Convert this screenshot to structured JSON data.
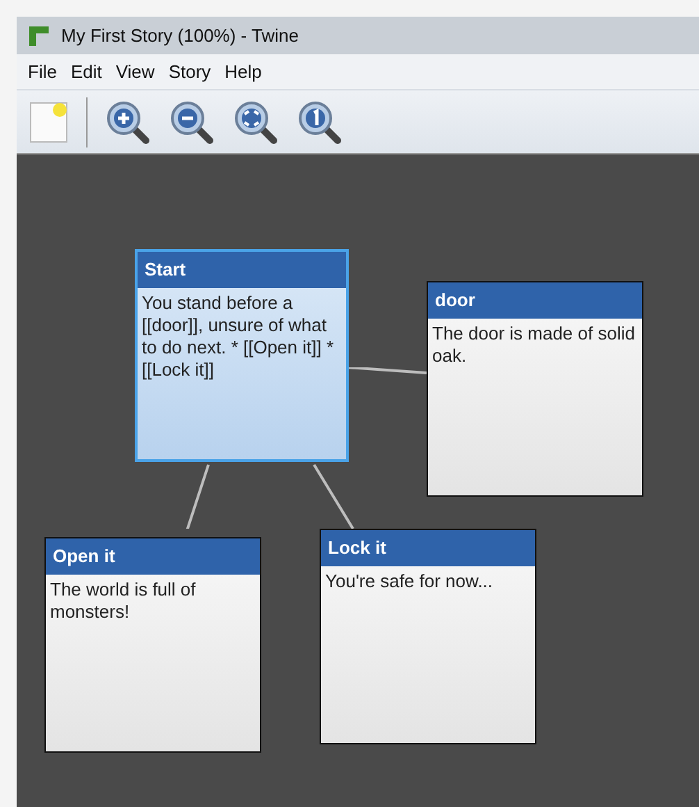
{
  "window": {
    "title": "My First Story (100%) - Twine"
  },
  "menu": [
    "File",
    "Edit",
    "View",
    "Story",
    "Help"
  ],
  "passages": [
    {
      "title": "Start",
      "text": "You stand before a [[door]], unsure of what to do next. * [[Open it]] * [[Lock it]]",
      "selected": true
    },
    {
      "title": "door",
      "text": "The door is made of solid oak.",
      "selected": false
    },
    {
      "title": "Open it",
      "text": "The world is full of monsters!",
      "selected": false
    },
    {
      "title": "Lock it",
      "text": "You're safe for now...",
      "selected": false
    }
  ]
}
